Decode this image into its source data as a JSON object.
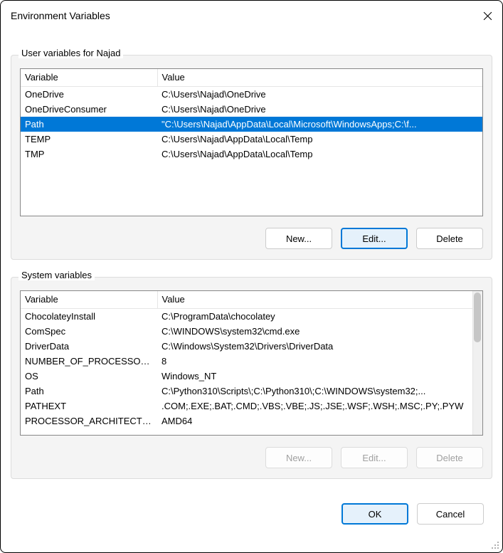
{
  "title": "Environment Variables",
  "user_section": {
    "label": "User variables for Najad",
    "columns": {
      "var": "Variable",
      "val": "Value"
    },
    "rows": [
      {
        "var": "OneDrive",
        "val": "C:\\Users\\Najad\\OneDrive",
        "selected": false
      },
      {
        "var": "OneDriveConsumer",
        "val": "C:\\Users\\Najad\\OneDrive",
        "selected": false
      },
      {
        "var": "Path",
        "val": "\"C:\\Users\\Najad\\AppData\\Local\\Microsoft\\WindowsApps;C:\\f...",
        "selected": true
      },
      {
        "var": "TEMP",
        "val": "C:\\Users\\Najad\\AppData\\Local\\Temp",
        "selected": false
      },
      {
        "var": "TMP",
        "val": "C:\\Users\\Najad\\AppData\\Local\\Temp",
        "selected": false
      }
    ],
    "buttons": {
      "new": "New...",
      "edit": "Edit...",
      "delete": "Delete"
    }
  },
  "system_section": {
    "label": "System variables",
    "columns": {
      "var": "Variable",
      "val": "Value"
    },
    "rows": [
      {
        "var": "ChocolateyInstall",
        "val": "C:\\ProgramData\\chocolatey"
      },
      {
        "var": "ComSpec",
        "val": "C:\\WINDOWS\\system32\\cmd.exe"
      },
      {
        "var": "DriverData",
        "val": "C:\\Windows\\System32\\Drivers\\DriverData"
      },
      {
        "var": "NUMBER_OF_PROCESSORS",
        "val": "8"
      },
      {
        "var": "OS",
        "val": "Windows_NT"
      },
      {
        "var": "Path",
        "val": "C:\\Python310\\Scripts\\;C:\\Python310\\;C:\\WINDOWS\\system32;..."
      },
      {
        "var": "PATHEXT",
        "val": ".COM;.EXE;.BAT;.CMD;.VBS;.VBE;.JS;.JSE;.WSF;.WSH;.MSC;.PY;.PYW"
      },
      {
        "var": "PROCESSOR_ARCHITECTU...",
        "val": "AMD64"
      }
    ],
    "buttons": {
      "new": "New...",
      "edit": "Edit...",
      "delete": "Delete"
    }
  },
  "dialog_buttons": {
    "ok": "OK",
    "cancel": "Cancel"
  }
}
